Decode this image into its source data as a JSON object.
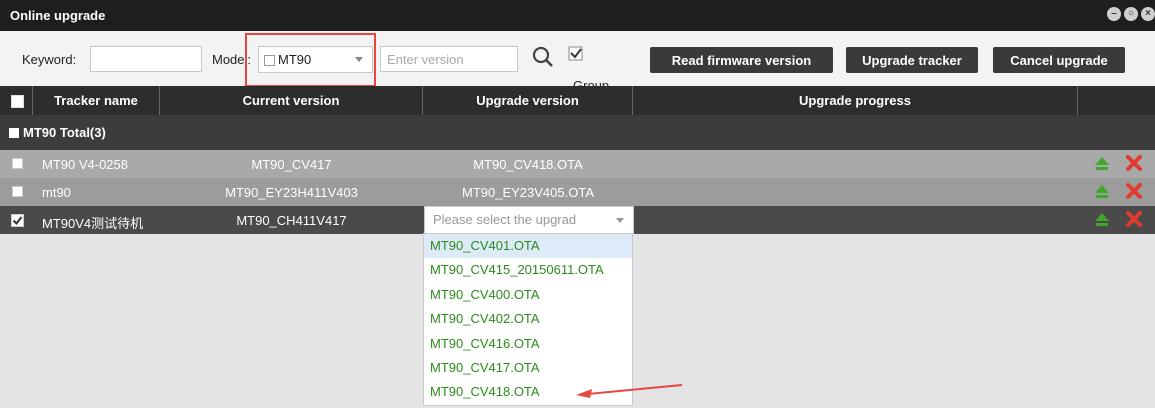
{
  "window": {
    "title": "Online upgrade"
  },
  "toolbar": {
    "keyword_label": "Keyword:",
    "keyword_value": "",
    "model_label": "Model:",
    "model_value": "MT90",
    "version_placeholder": "Enter version",
    "group_label": "Group",
    "buttons": {
      "read_firmware": "Read firmware version",
      "upgrade_tracker": "Upgrade tracker",
      "cancel_upgrade": "Cancel upgrade"
    }
  },
  "table": {
    "columns": [
      "Tracker name",
      "Current version",
      "Upgrade version",
      "Upgrade progress"
    ],
    "group": "MT90 Total(3)",
    "rows": [
      {
        "name": "MT90 V4-0258",
        "current": "MT90_CV417",
        "upgrade": "MT90_CV418.OTA",
        "checked": false
      },
      {
        "name": "mt90",
        "current": "MT90_EY23H411V403",
        "upgrade": "MT90_EY23V405.OTA",
        "checked": false
      },
      {
        "name": "MT90V4测试待机",
        "current": "MT90_CH411V417",
        "upgrade_placeholder": "Please select the upgrad",
        "checked": true
      }
    ]
  },
  "dropdown": {
    "options": [
      "MT90_CV401.OTA",
      "MT90_CV415_20150611.OTA",
      "MT90_CV400.OTA",
      "MT90_CV402.OTA",
      "MT90_CV416.OTA",
      "MT90_CV417.OTA",
      "MT90_CV418.OTA"
    ]
  },
  "colors": {
    "accent_red": "#e8463f",
    "option_green": "#2b8a1c",
    "upgrade_icon_green": "#3fa82c",
    "delete_icon_red": "#e23a2e"
  }
}
